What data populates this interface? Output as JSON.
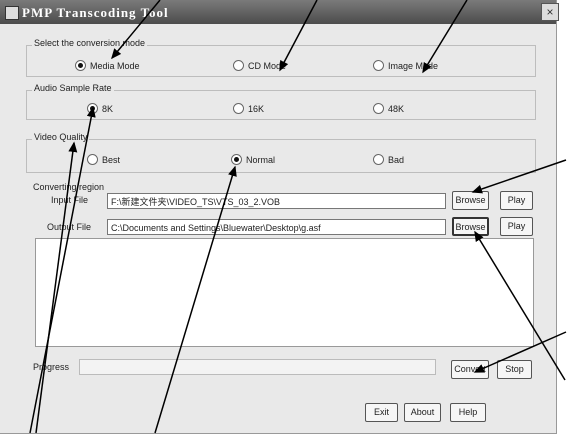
{
  "window": {
    "title": "PMP Transcoding Tool",
    "close_glyph": "×"
  },
  "conversion_mode": {
    "label": "Select the conversion mode",
    "options": [
      "Media Mode",
      "CD Mode",
      "Image Mode"
    ],
    "selected": "Media Mode"
  },
  "audio_rate": {
    "label": "Audio Sample Rate",
    "options": [
      "8K",
      "16K",
      "48K"
    ],
    "selected": "8K"
  },
  "video_quality": {
    "label": "Video Quality",
    "options": [
      "Best",
      "Normal",
      "Bad"
    ],
    "selected": "Normal"
  },
  "converting": {
    "label": "Converting region",
    "input_label": "Input File",
    "input_value": "F:\\新建文件夹\\VIDEO_TS\\VTS_03_2.VOB",
    "output_label": "Output File",
    "output_value": "C:\\Documents and Settings\\Bluewater\\Desktop\\g.asf",
    "browse_label": "Browse",
    "play_label": "Play"
  },
  "progress": {
    "label": "Progress",
    "convert_label": "Convert",
    "stop_label": "Stop"
  },
  "footer": {
    "exit_label": "Exit",
    "about_label": "About",
    "help_label": "Help"
  },
  "icons": [
    "app-icon",
    "close-icon"
  ]
}
